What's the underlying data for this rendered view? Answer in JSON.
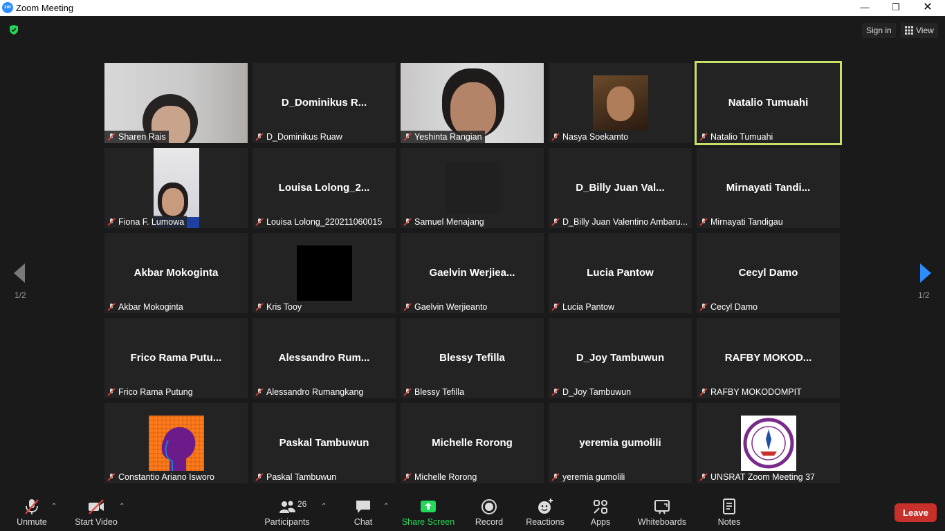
{
  "window": {
    "title": "Zoom Meeting"
  },
  "header": {
    "sign_in": "Sign in",
    "view": "View"
  },
  "pager": {
    "left": "1/2",
    "right": "1/2"
  },
  "tiles": [
    {
      "big": "",
      "name": "Sharen Rais"
    },
    {
      "big": "D_Dominikus  R...",
      "name": "D_Dominikus Ruaw"
    },
    {
      "big": "",
      "name": "Yeshinta Rangian"
    },
    {
      "big": "",
      "name": "Nasya Soekamto"
    },
    {
      "big": "Natalio Tumuahi",
      "name": "Natalio Tumuahi"
    },
    {
      "big": "",
      "name": "Fiona F. Lumowa"
    },
    {
      "big": "Louisa  Lolong_2...",
      "name": "Louisa Lolong_220211060015"
    },
    {
      "big": "",
      "name": "Samuel Menajang"
    },
    {
      "big": "D_Billy  Juan  Val...",
      "name": "D_Billy Juan Valentino Ambaru..."
    },
    {
      "big": "Mirnayati  Tandi...",
      "name": "Mirnayati Tandigau"
    },
    {
      "big": "Akbar Mokoginta",
      "name": "Akbar Mokoginta"
    },
    {
      "big": "",
      "name": "Kris Tooy"
    },
    {
      "big": "Gaelvin  Werjiea...",
      "name": "Gaelvin Werjieanto"
    },
    {
      "big": "Lucia Pantow",
      "name": "Lucia Pantow"
    },
    {
      "big": "Cecyl Damo",
      "name": "Cecyl Damo"
    },
    {
      "big": "Frico  Rama  Putu...",
      "name": "Frico Rama Putung"
    },
    {
      "big": "Alessandro  Rum...",
      "name": "Alessandro Rumangkang"
    },
    {
      "big": "Blessy Tefilla",
      "name": "Blessy Tefilla"
    },
    {
      "big": "D_Joy Tambuwun",
      "name": "D_Joy Tambuwun"
    },
    {
      "big": "RAFBY  MOKOD...",
      "name": "RAFBY MOKODOMPIT"
    },
    {
      "big": "",
      "name": "Constantio Ariano Isworo"
    },
    {
      "big": "Paskal Tambuwun",
      "name": "Paskal Tambuwun"
    },
    {
      "big": "Michelle Rorong",
      "name": "Michelle Rorong"
    },
    {
      "big": "yeremia gumolili",
      "name": "yeremia gumolili"
    },
    {
      "big": "",
      "name": "UNSRAT Zoom Meeting 37"
    }
  ],
  "toolbar": {
    "unmute": "Unmute",
    "start_video": "Start Video",
    "participants": "Participants",
    "participants_count": "26",
    "chat": "Chat",
    "share_screen": "Share Screen",
    "record": "Record",
    "reactions": "Reactions",
    "apps": "Apps",
    "whiteboards": "Whiteboards",
    "notes": "Notes",
    "leave": "Leave"
  },
  "colors": {
    "accent_green": "#23d959",
    "active_border": "#c7e06a",
    "leave_red": "#c8302b",
    "arrow_blue": "#2d8cff"
  }
}
